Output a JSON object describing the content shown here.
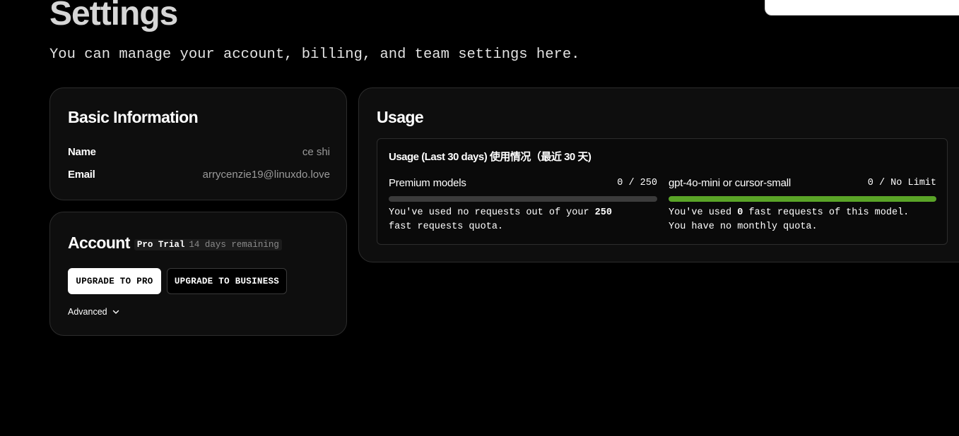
{
  "header": {
    "title": "Settings",
    "subtitle": "You can manage your account, billing, and team settings here."
  },
  "basic_info": {
    "title": "Basic Information",
    "rows": [
      {
        "label": "Name",
        "value": "ce shi"
      },
      {
        "label": "Email",
        "value": "arrycenzie19@linuxdo.love"
      }
    ]
  },
  "account": {
    "title": "Account",
    "plan_name": "Pro Trial",
    "plan_remaining": "14 days remaining",
    "upgrade_pro_label": "UPGRADE TO PRO",
    "upgrade_business_label": "UPGRADE TO BUSINESS",
    "advanced_label": "Advanced"
  },
  "usage": {
    "title": "Usage",
    "panel_title": "Usage (Last 30 days) 使用情况（最近 30 天)",
    "meters": [
      {
        "name": "Premium models",
        "count": "0 / 250",
        "used": 0,
        "fill_fraction": 0,
        "desc_prefix": "You've used no requests out of your ",
        "desc_bold": "250",
        "desc_suffix": "\nfast requests quota."
      },
      {
        "name": "gpt-4o-mini or cursor-small",
        "count": "0 / No Limit",
        "fill_fraction": 1,
        "desc_prefix": "You've used ",
        "desc_bold": "0",
        "desc_suffix": " fast requests of this model.\nYou have no monthly quota."
      }
    ]
  },
  "colors": {
    "background": "#000000",
    "card": "#0e0e0e",
    "border": "#2c2c2c",
    "progress_fill": "#5aa427",
    "progress_track": "#3b3b3b"
  }
}
